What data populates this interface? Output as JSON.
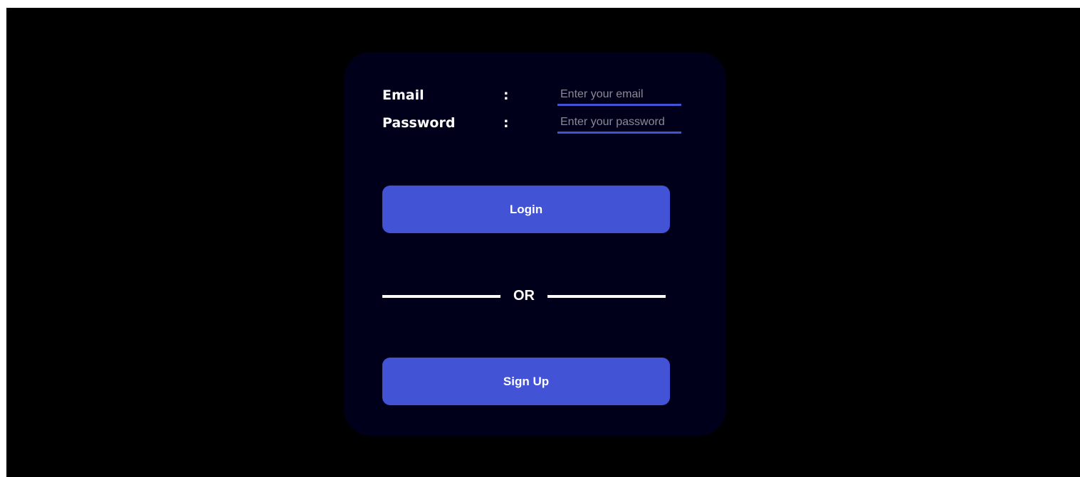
{
  "login_form": {
    "email": {
      "label": "Email",
      "separator": ":",
      "value": "",
      "placeholder": "Enter your email"
    },
    "password": {
      "label": "Password",
      "separator": ":",
      "value": "",
      "placeholder": "Enter your password"
    },
    "login_button_label": "Login",
    "divider_text": "OR",
    "signup_button_label": "Sign Up"
  },
  "colors": {
    "page_background": "#000000",
    "card_background": "#00001a",
    "accent": "#4353d6",
    "text": "#ffffff",
    "placeholder": "#8a8a95"
  }
}
